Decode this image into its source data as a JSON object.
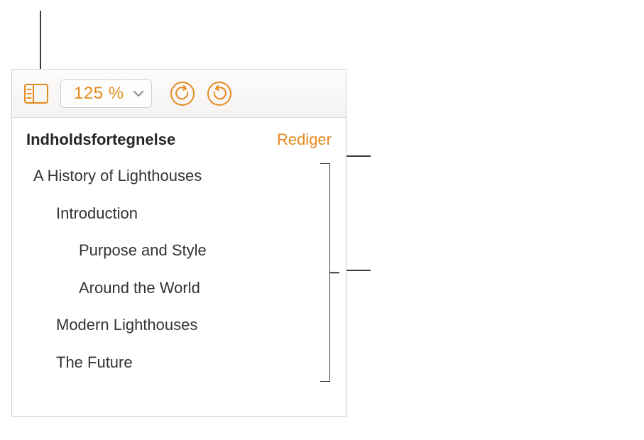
{
  "toolbar": {
    "zoom_value": "125 %"
  },
  "sidebar": {
    "title": "Indholdsfortegnelse",
    "edit_label": "Rediger",
    "entries": [
      {
        "label": "A History of Lighthouses",
        "level": 1
      },
      {
        "label": "Introduction",
        "level": 2
      },
      {
        "label": "Purpose and Style",
        "level": 3
      },
      {
        "label": "Around the World",
        "level": 3
      },
      {
        "label": "Modern Lighthouses",
        "level": 2
      },
      {
        "label": "The Future",
        "level": 2
      }
    ]
  }
}
